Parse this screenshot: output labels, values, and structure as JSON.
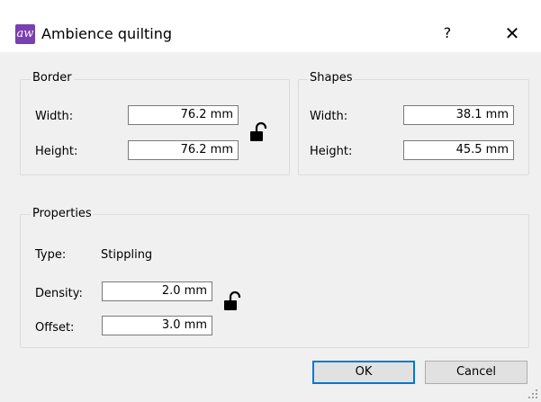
{
  "window": {
    "title": "Ambience quilting",
    "app_icon_text": "aw",
    "help_label": "?",
    "close_label": "✕"
  },
  "border": {
    "title": "Border",
    "width_label": "Width:",
    "width_value": "76.2 mm",
    "height_label": "Height:",
    "height_value": "76.2 mm"
  },
  "shapes": {
    "title": "Shapes",
    "width_label": "Width:",
    "width_value": "38.1 mm",
    "height_label": "Height:",
    "height_value": "45.5 mm"
  },
  "properties": {
    "title": "Properties",
    "type_label": "Type:",
    "type_value": "Stippling",
    "density_label": "Density:",
    "density_value": "2.0 mm",
    "offset_label": "Offset:",
    "offset_value": "3.0 mm"
  },
  "buttons": {
    "ok": "OK",
    "cancel": "Cancel"
  }
}
